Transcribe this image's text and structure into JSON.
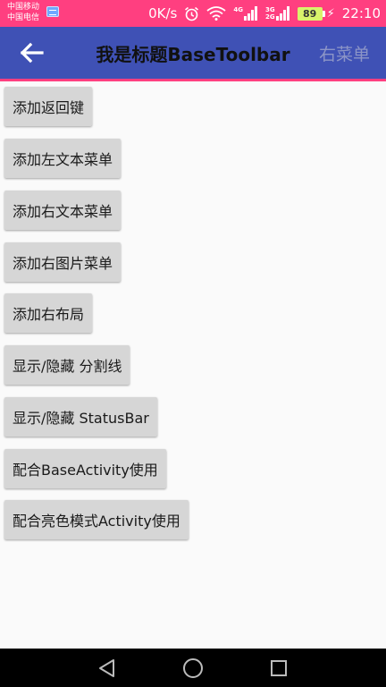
{
  "status_bar": {
    "carrier_1": "中国移动",
    "carrier_2": "中国电信",
    "net_speed": "0K/s",
    "net_type_1": "4G",
    "net_type_2": "3G",
    "net_type_3": "2G",
    "battery_level": "89",
    "time": "22:10",
    "background_color": "#ff3f80"
  },
  "toolbar": {
    "title": "我是标题BaseToolbar",
    "right_menu": "右菜单",
    "background_color": "#3f51b5",
    "divider_color": "#ff3f80"
  },
  "buttons": [
    {
      "label": "添加返回键"
    },
    {
      "label": "添加左文本菜单"
    },
    {
      "label": "添加右文本菜单"
    },
    {
      "label": "添加右图片菜单"
    },
    {
      "label": "添加右布局"
    },
    {
      "label": "显示/隐藏 分割线"
    },
    {
      "label": "显示/隐藏 StatusBar"
    },
    {
      "label": "配合BaseActivity使用"
    },
    {
      "label": "配合亮色模式Activity使用"
    }
  ],
  "nav_bar": {
    "icons": [
      "back-triangle-icon",
      "home-circle-icon",
      "recents-square-icon"
    ]
  }
}
